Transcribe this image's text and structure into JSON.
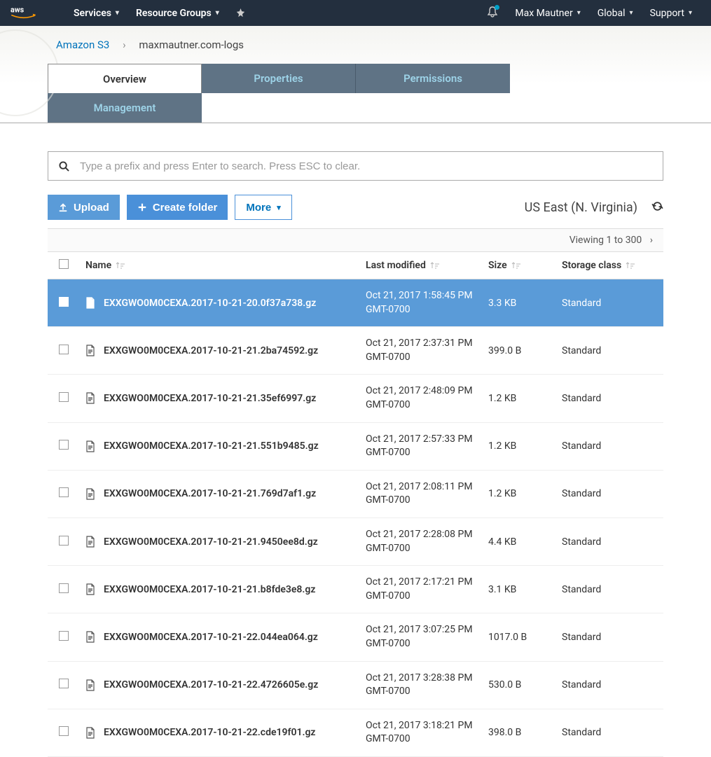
{
  "topnav": {
    "logo_text": "aws",
    "services": "Services",
    "resource_groups": "Resource Groups",
    "user": "Max Mautner",
    "region": "Global",
    "support": "Support"
  },
  "breadcrumb": {
    "root": "Amazon S3",
    "bucket": "maxmautner.com-logs"
  },
  "tabs": {
    "overview": "Overview",
    "properties": "Properties",
    "permissions": "Permissions",
    "management": "Management"
  },
  "search": {
    "placeholder": "Type a prefix and press Enter to search. Press ESC to clear."
  },
  "actions": {
    "upload": "Upload",
    "create_folder": "Create folder",
    "more": "More",
    "region": "US East (N. Virginia)"
  },
  "pagination": {
    "viewing": "Viewing 1 to 300"
  },
  "columns": {
    "name": "Name",
    "last_modified": "Last modified",
    "size": "Size",
    "storage_class": "Storage class"
  },
  "rows": [
    {
      "selected": true,
      "name": "EXXGWO0M0CEXA.2017-10-21-20.0f37a738.gz",
      "date1": "Oct 21, 2017 1:58:45 PM",
      "date2": "GMT-0700",
      "size": "3.3 KB",
      "class": "Standard"
    },
    {
      "selected": false,
      "name": "EXXGWO0M0CEXA.2017-10-21-21.2ba74592.gz",
      "date1": "Oct 21, 2017 2:37:31 PM",
      "date2": "GMT-0700",
      "size": "399.0 B",
      "class": "Standard"
    },
    {
      "selected": false,
      "name": "EXXGWO0M0CEXA.2017-10-21-21.35ef6997.gz",
      "date1": "Oct 21, 2017 2:48:09 PM",
      "date2": "GMT-0700",
      "size": "1.2 KB",
      "class": "Standard"
    },
    {
      "selected": false,
      "name": "EXXGWO0M0CEXA.2017-10-21-21.551b9485.gz",
      "date1": "Oct 21, 2017 2:57:33 PM",
      "date2": "GMT-0700",
      "size": "1.2 KB",
      "class": "Standard"
    },
    {
      "selected": false,
      "name": "EXXGWO0M0CEXA.2017-10-21-21.769d7af1.gz",
      "date1": "Oct 21, 2017 2:08:11 PM",
      "date2": "GMT-0700",
      "size": "1.2 KB",
      "class": "Standard"
    },
    {
      "selected": false,
      "name": "EXXGWO0M0CEXA.2017-10-21-21.9450ee8d.gz",
      "date1": "Oct 21, 2017 2:28:08 PM",
      "date2": "GMT-0700",
      "size": "4.4 KB",
      "class": "Standard"
    },
    {
      "selected": false,
      "name": "EXXGWO0M0CEXA.2017-10-21-21.b8fde3e8.gz",
      "date1": "Oct 21, 2017 2:17:21 PM",
      "date2": "GMT-0700",
      "size": "3.1 KB",
      "class": "Standard"
    },
    {
      "selected": false,
      "name": "EXXGWO0M0CEXA.2017-10-21-22.044ea064.gz",
      "date1": "Oct 21, 2017 3:07:25 PM",
      "date2": "GMT-0700",
      "size": "1017.0 B",
      "class": "Standard"
    },
    {
      "selected": false,
      "name": "EXXGWO0M0CEXA.2017-10-21-22.4726605e.gz",
      "date1": "Oct 21, 2017 3:28:38 PM",
      "date2": "GMT-0700",
      "size": "530.0 B",
      "class": "Standard"
    },
    {
      "selected": false,
      "name": "EXXGWO0M0CEXA.2017-10-21-22.cde19f01.gz",
      "date1": "Oct 21, 2017 3:18:21 PM",
      "date2": "GMT-0700",
      "size": "398.0 B",
      "class": "Standard"
    }
  ]
}
